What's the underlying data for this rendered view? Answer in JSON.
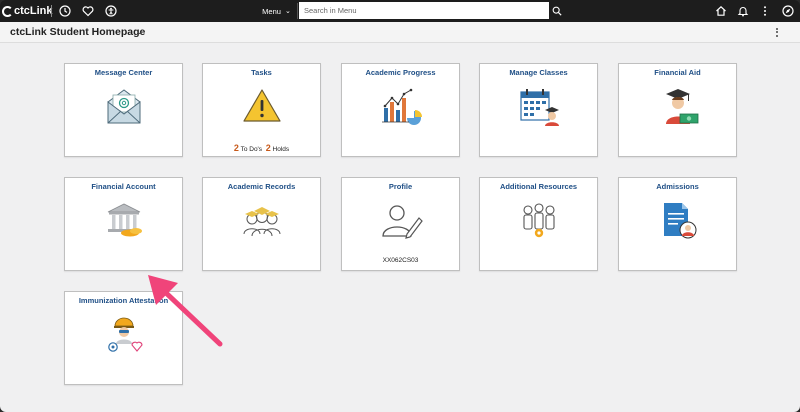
{
  "topbar": {
    "logo_text": "ctcLink",
    "menu_label": "Menu",
    "search_placeholder": "Search in Menu"
  },
  "header": {
    "title": "ctcLink Student Homepage"
  },
  "tiles": [
    {
      "title": "Message Center"
    },
    {
      "title": "Tasks",
      "todo_count": "2",
      "todo_label": "To Do's",
      "holds_count": "2",
      "holds_label": "Holds"
    },
    {
      "title": "Academic Progress"
    },
    {
      "title": "Manage Classes"
    },
    {
      "title": "Financial Aid"
    },
    {
      "title": "Financial Account"
    },
    {
      "title": "Academic Records"
    },
    {
      "title": "Profile",
      "subtitle": "XX062CS03"
    },
    {
      "title": "Additional Resources"
    },
    {
      "title": "Admissions"
    },
    {
      "title": "Immunization Attestation"
    }
  ],
  "colors": {
    "tile_title": "#1f4f86",
    "annotation_arrow": "#f0447a",
    "topbar": "#1d1d1d"
  }
}
